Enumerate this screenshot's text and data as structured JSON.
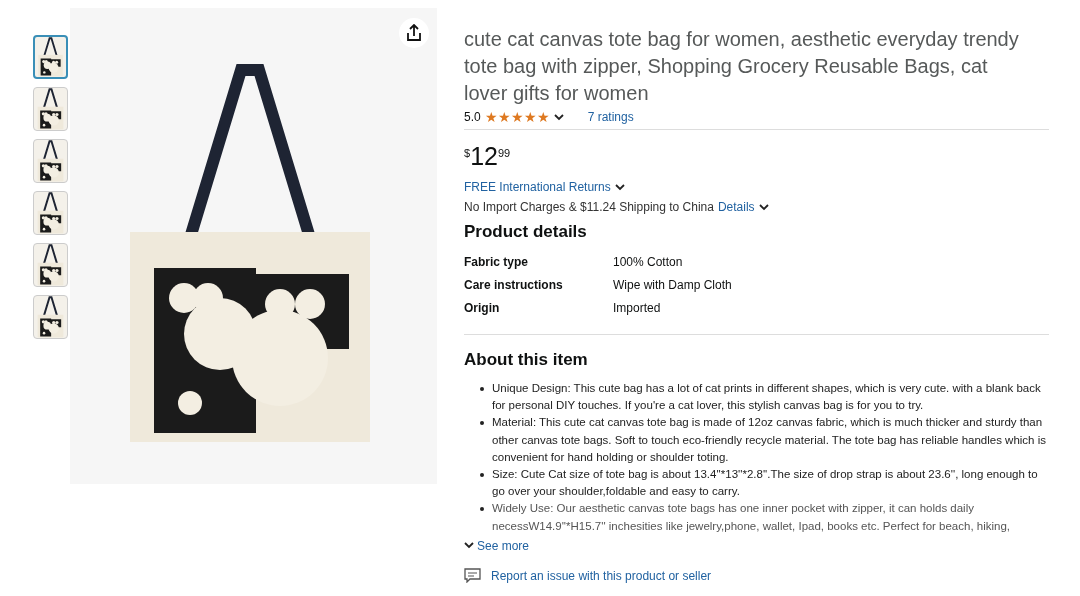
{
  "gallery": {
    "thumbnails": [
      {
        "selected": true
      },
      {
        "selected": false
      },
      {
        "selected": false
      },
      {
        "selected": false
      },
      {
        "selected": false
      },
      {
        "selected": false
      }
    ]
  },
  "product": {
    "title": "cute cat canvas tote bag for women, aesthetic everyday trendy tote bag with zipper, Shopping Grocery Reusable Bags, cat lover gifts for women",
    "rating": "5.0",
    "stars": 5,
    "ratings_link": "7 ratings",
    "price": {
      "currency": "$",
      "whole": "12",
      "fraction": "99"
    },
    "returns_link": "FREE International Returns",
    "shipping": "No Import Charges & $11.24 Shipping to China",
    "shipping_link": "Details"
  },
  "product_details": {
    "heading": "Product details",
    "rows": [
      {
        "label": "Fabric type",
        "value": "100% Cotton"
      },
      {
        "label": "Care instructions",
        "value": "Wipe with Damp Cloth"
      },
      {
        "label": "Origin",
        "value": "Imported"
      }
    ]
  },
  "about": {
    "heading": "About this item",
    "bullets": [
      "Unique Design: This cute bag has a lot of cat prints in different shapes, which is very cute. with a blank back for personal DIY touches. If you're a cat lover, this stylish canvas bag is for you to try.",
      "Material: This cute cat canvas tote bag is made of 12oz canvas fabric, which is much thicker and sturdy than other canvas tote bags. Soft to touch eco-friendly recycle material. The tote bag has reliable handles which is convenient for hand holding or shoulder toting.",
      "Size: Cute Cat size of tote bag is about 13.4''*13''*2.8''.The size of drop strap is about 23.6'', long enough to go over your shoulder,foldable and easy to carry.",
      "Widely Use: Our aesthetic canvas tote bags has one inner pocket with zipper, it can holds daily necessW14.9''*H15.7'' inchesities like jewelry,phone, wallet, Ipad, books etc. Perfect for beach, hiking,"
    ],
    "see_more": "See more"
  },
  "report_link": "Report an issue with this product or seller"
}
